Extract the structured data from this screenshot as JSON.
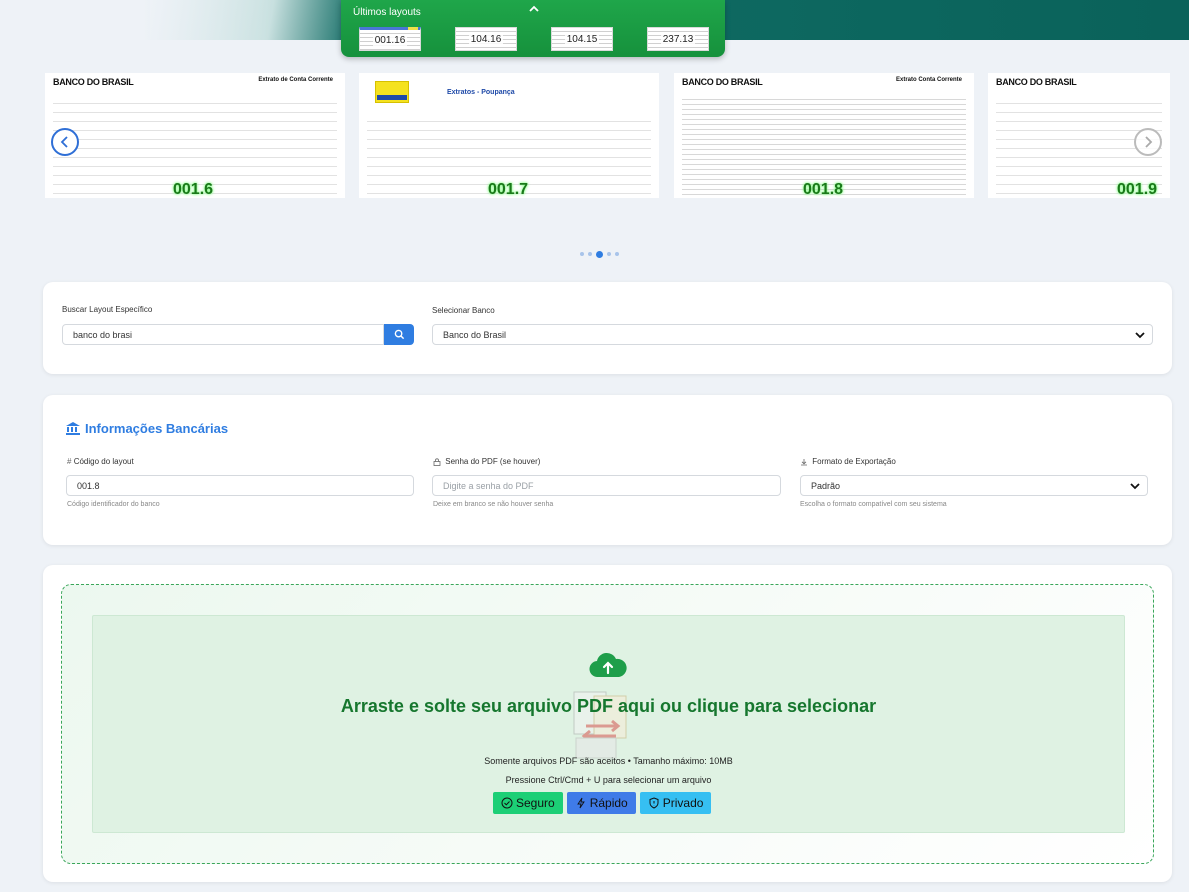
{
  "recent_layouts": {
    "title": "Últimos layouts",
    "items": [
      "001.16",
      "104.16",
      "104.15",
      "237.13"
    ]
  },
  "carousel": {
    "slides": [
      {
        "bank": "BANCO DO BRASIL",
        "doc_title": "Extrato de Conta Corrente",
        "code": "001.6"
      },
      {
        "bank": "",
        "doc_title": "Extratos - Poupança",
        "code": "001.7"
      },
      {
        "bank": "BANCO DO BRASIL",
        "doc_title": "Extrato Conta Corrente",
        "code": "001.8"
      },
      {
        "bank": "BANCO DO BRASIL",
        "doc_title": "",
        "code": "001.9"
      }
    ],
    "dots": 5,
    "active_dot": 3
  },
  "search_card": {
    "search_label": "Buscar Layout Específico",
    "search_value": "banco do brasi",
    "bank_label": "Selecionar Banco",
    "bank_value": "Banco do Brasil"
  },
  "bank_info": {
    "title": "Informações Bancárias",
    "code_label": "Código do layout",
    "code_value": "001.8",
    "code_hint": "Código identificador do banco",
    "password_label": "Senha do PDF (se houver)",
    "password_placeholder": "Digite a senha do PDF",
    "password_hint": "Deixe em branco se não houver senha",
    "format_label": "Formato de Exportação",
    "format_value": "Padrão",
    "format_hint": "Escolha o formato compatível com seu sistema"
  },
  "upload": {
    "title": "Arraste e solte seu arquivo PDF aqui ou clique para selecionar",
    "info": "Somente arquivos PDF são aceitos • Tamanho máximo: 10MB",
    "shortcut": "Pressione Ctrl/Cmd + U para selecionar um arquivo",
    "badges": [
      "Seguro",
      "Rápido",
      "Privado"
    ]
  },
  "colors": {
    "accent": "#2f7de1",
    "header_teal": "#0a625a",
    "green": "#16772e"
  }
}
